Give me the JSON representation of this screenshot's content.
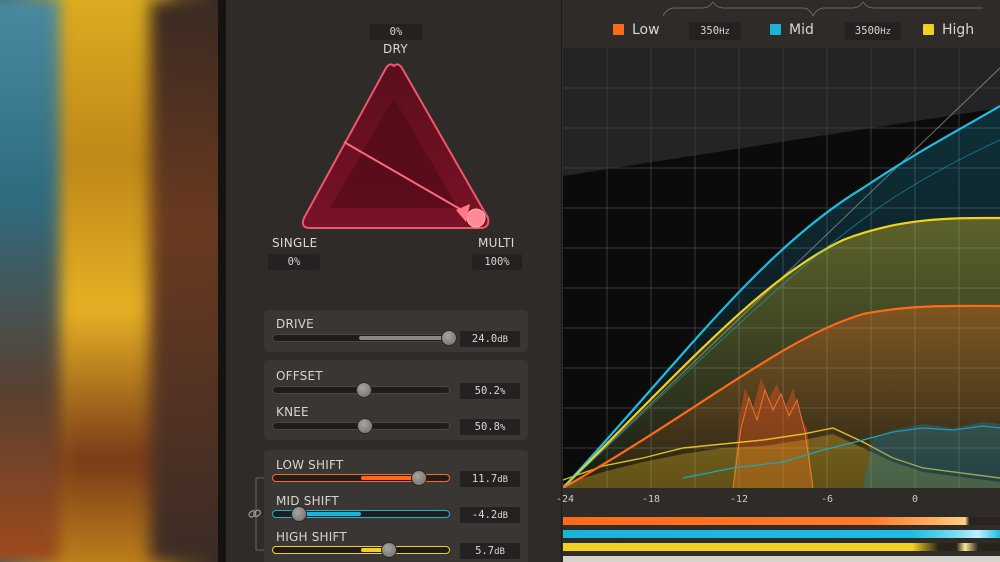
{
  "triangle": {
    "dry_value": "0%",
    "dry_label": "DRY",
    "single_label": "SINGLE",
    "single_value": "0%",
    "multi_label": "MULTI",
    "multi_value": "100%",
    "accent": "#e4445a"
  },
  "sliders": {
    "drive": {
      "label": "DRIVE",
      "value": "24.0",
      "unit": "dB",
      "level": 1.0
    },
    "offset": {
      "label": "OFFSET",
      "value": "50.2",
      "unit": "%",
      "level": 0.5
    },
    "knee": {
      "label": "KNEE",
      "value": "50.8",
      "unit": "%",
      "level": 0.51
    },
    "low_shift": {
      "label": "LOW SHIFT",
      "value": "11.7",
      "unit": "dB",
      "level": 0.82,
      "color": "#ff6a1a"
    },
    "mid_shift": {
      "label": "MID SHIFT",
      "value": "-4.2",
      "unit": "dB",
      "level": 0.15,
      "color": "#1ab4d8"
    },
    "high_shift": {
      "label": "HIGH SHIFT",
      "value": "5.7",
      "unit": "dB",
      "level": 0.66,
      "color": "#f0d020"
    }
  },
  "legend": {
    "low": {
      "label": "Low",
      "color": "#ff6a1a"
    },
    "crossover_1": {
      "value": "350",
      "unit": "Hz"
    },
    "mid": {
      "label": "Mid",
      "color": "#1ab4d8"
    },
    "crossover_2": {
      "value": "3500",
      "unit": "Hz"
    },
    "high": {
      "label": "High",
      "color": "#f0d020"
    }
  },
  "x_axis": {
    "ticks": [
      "-24",
      "-18",
      "-12",
      "-6",
      "0"
    ]
  },
  "icons": {
    "link": "link-icon"
  }
}
